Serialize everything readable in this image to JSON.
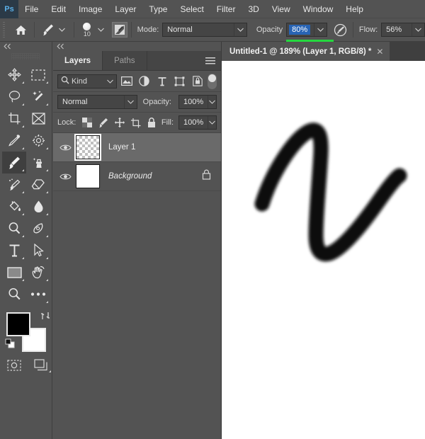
{
  "app": {
    "name": "Adobe Photoshop",
    "logo_text": "Ps"
  },
  "menubar": {
    "items": [
      {
        "label": "File"
      },
      {
        "label": "Edit"
      },
      {
        "label": "Image"
      },
      {
        "label": "Layer"
      },
      {
        "label": "Type"
      },
      {
        "label": "Select"
      },
      {
        "label": "Filter"
      },
      {
        "label": "3D"
      },
      {
        "label": "View"
      },
      {
        "label": "Window"
      },
      {
        "label": "Help"
      }
    ]
  },
  "options_bar": {
    "home_icon": "home-icon",
    "brush_preview_icon": "brush-icon",
    "brush_size": "10",
    "brush_panel_icon": "brush-settings-icon",
    "mode_label": "Mode:",
    "mode_value": "Normal",
    "opacity_label": "Opacity",
    "opacity_value": "80%",
    "opacity_highlight_color": "#25d83f",
    "opacity_selection_color": "#2864b4",
    "airbrush_icon": "airbrush-icon",
    "flow_label": "Flow:",
    "flow_value": "56%"
  },
  "toolbar": {
    "collapse_icon": "double-chevron-left-icon",
    "tools": [
      {
        "name": "move-tool",
        "icon": "move-icon",
        "active": false,
        "has_more": true
      },
      {
        "name": "rectangular-marquee-tool",
        "icon": "marquee-icon",
        "active": false,
        "has_more": true
      },
      {
        "name": "lasso-tool",
        "icon": "lasso-icon",
        "active": false,
        "has_more": true
      },
      {
        "name": "quick-selection-tool",
        "icon": "magic-wand-icon",
        "active": false,
        "has_more": true
      },
      {
        "name": "crop-tool",
        "icon": "crop-icon",
        "active": false,
        "has_more": true
      },
      {
        "name": "frame-tool",
        "icon": "frame-icon",
        "active": false,
        "has_more": false
      },
      {
        "name": "eyedropper-tool",
        "icon": "eyedropper-icon",
        "active": false,
        "has_more": true
      },
      {
        "name": "spot-healing-brush-tool",
        "icon": "healing-brush-icon",
        "active": false,
        "has_more": true
      },
      {
        "name": "brush-tool",
        "icon": "brush-icon",
        "active": true,
        "has_more": true
      },
      {
        "name": "clone-stamp-tool",
        "icon": "clone-stamp-icon",
        "active": false,
        "has_more": true
      },
      {
        "name": "history-brush-tool",
        "icon": "history-brush-icon",
        "active": false,
        "has_more": true
      },
      {
        "name": "eraser-tool",
        "icon": "eraser-icon",
        "active": false,
        "has_more": true
      },
      {
        "name": "gradient-tool",
        "icon": "paint-bucket-icon",
        "active": false,
        "has_more": true
      },
      {
        "name": "blur-tool",
        "icon": "blur-drop-icon",
        "active": false,
        "has_more": true
      },
      {
        "name": "dodge-tool",
        "icon": "dodge-icon",
        "active": false,
        "has_more": true
      },
      {
        "name": "pen-tool",
        "icon": "pen-icon",
        "active": false,
        "has_more": true
      },
      {
        "name": "type-tool",
        "icon": "type-t-icon",
        "active": false,
        "has_more": true
      },
      {
        "name": "path-selection-tool",
        "icon": "path-arrow-icon",
        "active": false,
        "has_more": true
      },
      {
        "name": "rectangle-tool",
        "icon": "rectangle-icon",
        "active": false,
        "has_more": true
      },
      {
        "name": "hand-tool",
        "icon": "hand-rotate-icon",
        "active": false,
        "has_more": true
      },
      {
        "name": "zoom-tool",
        "icon": "magnifier-icon",
        "active": false,
        "has_more": false
      },
      {
        "name": "edit-toolbar-tool",
        "icon": "ellipsis-icon",
        "active": false,
        "has_more": true
      }
    ],
    "foreground_color": "#000000",
    "background_color": "#ffffff",
    "swap_icon": "swap-colors-icon",
    "default_colors_icon": "default-colors-icon",
    "quick_mask_icon": "quick-mask-icon",
    "screen_mode_icon": "screen-mode-icon"
  },
  "layers_panel": {
    "collapse_icon": "double-chevron-left-icon",
    "tabs": [
      {
        "label": "Layers",
        "active": true
      },
      {
        "label": "Paths",
        "active": false
      }
    ],
    "menu_icon": "panel-menu-icon",
    "filter": {
      "search_icon": "search-icon",
      "kind_label": "Kind",
      "dropdown_icon": "chevron-down-icon",
      "icons": [
        {
          "name": "filter-pixel-icon"
        },
        {
          "name": "filter-adjustment-icon"
        },
        {
          "name": "filter-type-icon"
        },
        {
          "name": "filter-shape-icon"
        },
        {
          "name": "filter-smart-object-icon"
        }
      ],
      "toggle_name": "filter-enable-toggle"
    },
    "blend_mode_label": "Normal",
    "opacity_label": "Opacity:",
    "opacity_value": "100%",
    "lock_label": "Lock:",
    "lock_icons": [
      {
        "name": "lock-transparent-pixels-icon"
      },
      {
        "name": "lock-image-pixels-icon"
      },
      {
        "name": "lock-position-icon"
      },
      {
        "name": "lock-artboard-nesting-icon"
      },
      {
        "name": "lock-all-icon"
      }
    ],
    "fill_label": "Fill:",
    "fill_value": "100%",
    "layers": [
      {
        "name": "Layer 1",
        "visible": true,
        "selected": true,
        "italic": false,
        "locked": false,
        "thumbnail": "transparent-checker"
      },
      {
        "name": "Background",
        "visible": true,
        "selected": false,
        "italic": true,
        "locked": true,
        "thumbnail": "white"
      }
    ]
  },
  "document": {
    "tab_title": "Untitled-1 @ 189% (Layer 1, RGB/8) *",
    "close_icon": "close-icon",
    "canvas_background": "#ffffff",
    "artwork_description": "hand-drawn black brush stroke shaped like a letter N",
    "artwork_color": "#0a0a0a"
  }
}
